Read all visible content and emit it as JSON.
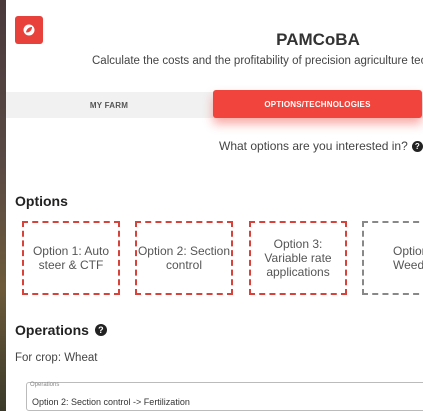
{
  "app": {
    "title": "PAMCoBA",
    "subtitle": "Calculate the costs and the profitability of precision agriculture tec",
    "logo_icon": "leaf-icon",
    "accent_color": "#f0443c"
  },
  "tabs": [
    {
      "label": "MY FARM",
      "active": false
    },
    {
      "label": "OPTIONS/TECHNOLOGIES",
      "active": true
    }
  ],
  "question": {
    "text": "What options are you interested in?",
    "icon": "question-circle-icon"
  },
  "options_section": {
    "heading": "Options",
    "cards": [
      {
        "label": "Option 1: Auto steer & CTF"
      },
      {
        "label": "Option 2: Section control"
      },
      {
        "label": "Option 3: Variable rate applications"
      },
      {
        "label": "Option Weedi"
      }
    ]
  },
  "operations_section": {
    "heading": "Operations",
    "icon": "question-circle-icon",
    "crop_text": "For crop: Wheat",
    "field_label": "Operations",
    "field_value": "Option 2: Section control -> Fertilization"
  }
}
